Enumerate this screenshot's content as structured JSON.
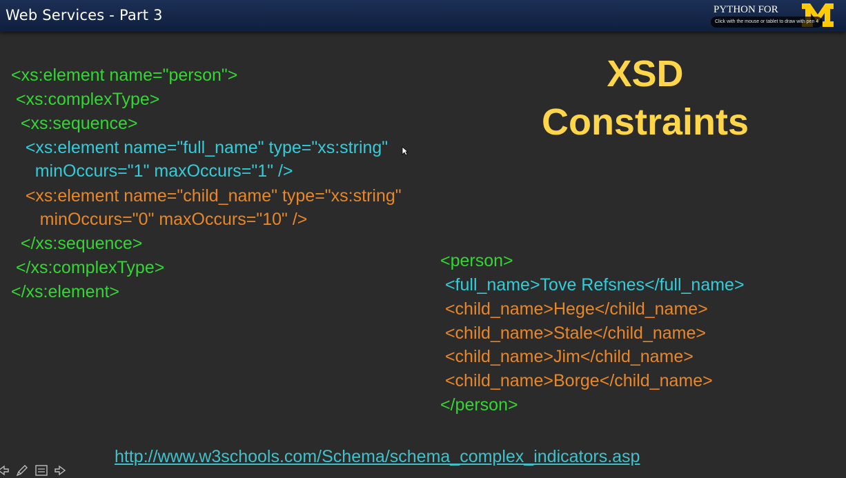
{
  "window": {
    "title": "Web Services - Part 3"
  },
  "branding": {
    "logo_text": "PYTHON FOR",
    "pen_hint": "Click with the mouse or tablet to draw with pen 4",
    "accent_color": "#ffcb05"
  },
  "slide": {
    "title_line1": "XSD",
    "title_line2": "Constraints",
    "schema_lines": [
      "<xs:element name=\"person\">",
      " <xs:complexType>",
      "  <xs:sequence>",
      "   <xs:element name=\"full_name\" type=\"xs:string\"",
      "     minOccurs=\"1\" maxOccurs=\"1\" />",
      "   <xs:element name=\"child_name\" type=\"xs:string\"",
      "      minOccurs=\"0\" maxOccurs=\"10\" />",
      "  </xs:sequence>",
      " </xs:complexType>",
      "</xs:element>"
    ],
    "xml_lines": [
      "<person>",
      " <full_name>Tove Refsnes</full_name>",
      " <child_name>Hege</child_name>",
      " <child_name>Stale</child_name>",
      " <child_name>Jim</child_name>",
      " <child_name>Borge</child_name>",
      "</person>"
    ],
    "link": "http://www.w3schools.com/Schema/schema_complex_indicators.asp"
  },
  "toolbar": {
    "icons": [
      "previous-icon",
      "pen-icon",
      "slides-icon",
      "next-icon"
    ]
  },
  "colors": {
    "green": "#33d633",
    "cyan": "#33ccd9",
    "orange": "#e8872a",
    "title": "#ffd54a",
    "link": "#41c1c9"
  }
}
